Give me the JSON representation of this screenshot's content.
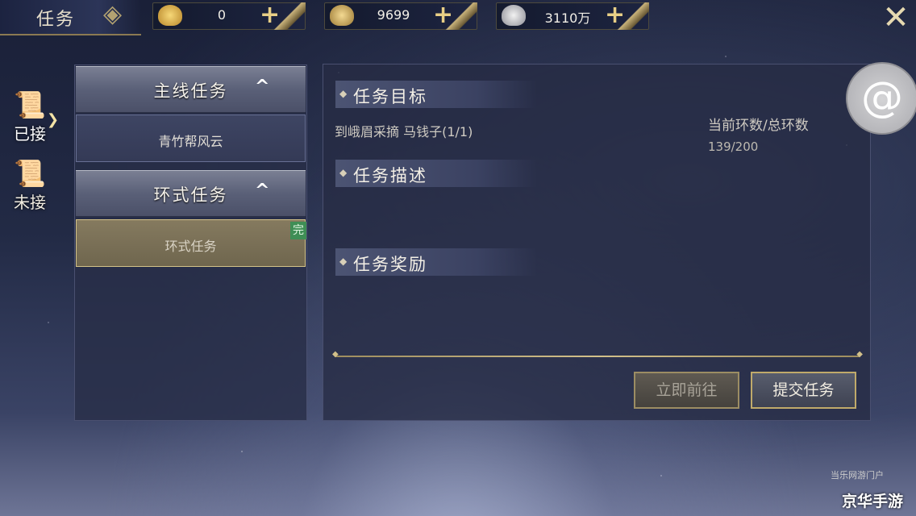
{
  "header": {
    "title": "任务",
    "currencies": [
      {
        "icon": "gold-ingot-icon",
        "value": "0"
      },
      {
        "icon": "gold-ingot-bundle-icon",
        "value": "9699"
      },
      {
        "icon": "silver-ingot-icon",
        "value": "3110万"
      }
    ],
    "add_symbol": "+",
    "close_symbol": "✕"
  },
  "side_tabs": [
    {
      "label": "已接",
      "icon": "scroll-icon",
      "active": true
    },
    {
      "label": "未接",
      "icon": "scroll-bundle-icon",
      "active": false
    }
  ],
  "task_list": {
    "categories": [
      {
        "label": "主线任务",
        "chevron": "^",
        "tasks": [
          {
            "label": "青竹帮风云",
            "selected": false
          }
        ]
      },
      {
        "label": "环式任务",
        "chevron": "^",
        "tasks": [
          {
            "label": "环式任务",
            "selected": true,
            "badge": "完"
          }
        ]
      }
    ]
  },
  "detail": {
    "sections": {
      "objective_title": "任务目标",
      "description_title": "任务描述",
      "reward_title": "任务奖励"
    },
    "objective_text": "到峨眉采摘 马钱子(1/1)",
    "loop_label": "当前环数/总环数",
    "loop_value": "139/200",
    "buttons": {
      "go_now": "立即前往",
      "submit": "提交任务"
    }
  },
  "watermark": {
    "site": "当乐网游门户",
    "brand": "京华手游"
  },
  "colors": {
    "accent_gold": "#c0aa6a",
    "complete_badge": "#3f8e55",
    "selected_item": "#857a5f"
  }
}
